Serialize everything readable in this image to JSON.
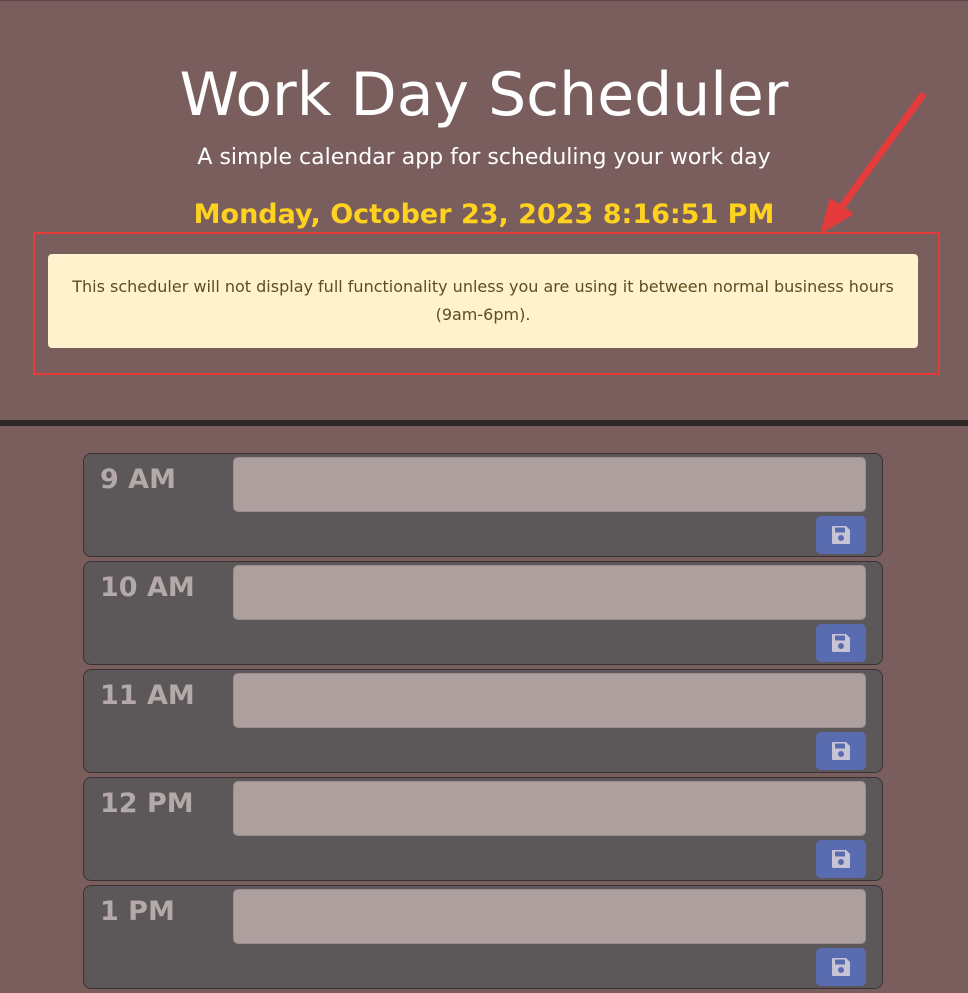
{
  "header": {
    "title": "Work Day Scheduler",
    "subtitle": "A simple calendar app for scheduling your work day",
    "datetime": "Monday, October 23, 2023 8:16:51 PM",
    "notice": "This scheduler will not display full functionality unless you are using it between normal business hours (9am-6pm)."
  },
  "annotation": {
    "box_color": "#e53b3b",
    "arrow_color": "#e53b3b"
  },
  "colors": {
    "background": "#7a5e5e",
    "datetime": "#ffd21f",
    "notice_bg": "#fff3cd",
    "row_bg": "#5c5758",
    "textarea_bg": "#ae9f9f",
    "save_button": "#5a6cb0"
  },
  "time_blocks": [
    {
      "hour": "9 AM",
      "text": "",
      "save_icon": "floppy-disk-icon"
    },
    {
      "hour": "10 AM",
      "text": "",
      "save_icon": "floppy-disk-icon"
    },
    {
      "hour": "11 AM",
      "text": "",
      "save_icon": "floppy-disk-icon"
    },
    {
      "hour": "12 PM",
      "text": "",
      "save_icon": "floppy-disk-icon"
    },
    {
      "hour": "1 PM",
      "text": "",
      "save_icon": "floppy-disk-icon"
    }
  ]
}
